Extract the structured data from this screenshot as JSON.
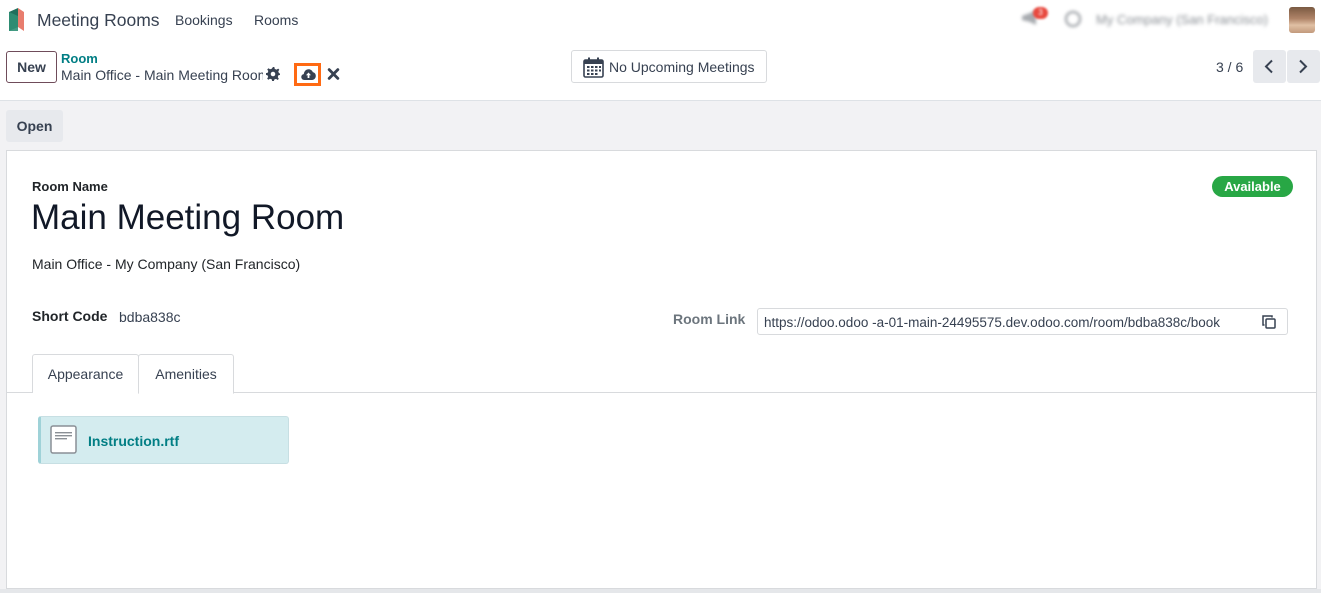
{
  "navbar": {
    "app_name": "Meeting Rooms",
    "menu": [
      "Bookings",
      "Rooms"
    ],
    "notification_count": "3",
    "company": "My Company (San Francisco)"
  },
  "control_panel": {
    "new_label": "New",
    "breadcrumb_parent": "Room",
    "breadcrumb_current": "Main Office - Main Meeting Room",
    "meetings_label": "No Upcoming Meetings",
    "pager": "3 / 6"
  },
  "statusbar": {
    "open_label": "Open"
  },
  "form": {
    "room_name_label": "Room Name",
    "room_name": "Main Meeting Room",
    "status": "Available",
    "location": "Main Office - My Company (San Francisco)",
    "short_code_label": "Short Code",
    "short_code": "bdba838c",
    "room_link_label": "Room Link",
    "room_link": "https://odoo.odoo -a-01-main-24495575.dev.odoo.com/room/bdba838c/book",
    "tabs": [
      "Appearance",
      "Amenities"
    ],
    "attachment_name": "Instruction.rtf"
  },
  "colors": {
    "accent": "#017e84",
    "status_green": "#28a745",
    "highlight_orange": "#ff6a13",
    "attachment_bg": "#d4ecef"
  },
  "icons": [
    "app-logo-icon",
    "megaphone-icon",
    "clock-icon",
    "gear-icon",
    "cloud-upload-icon",
    "close-icon",
    "calendar-icon",
    "chevron-left-icon",
    "chevron-right-icon",
    "copy-icon",
    "file-icon"
  ]
}
